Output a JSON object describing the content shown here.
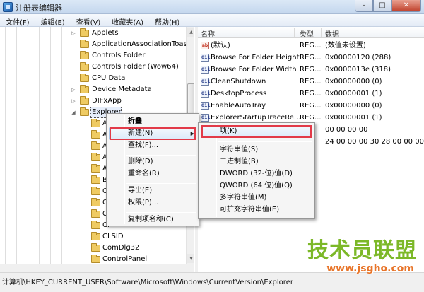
{
  "window": {
    "title": "注册表编辑器",
    "controls": {
      "minimize": "–",
      "maximize": "□",
      "close": "✕"
    }
  },
  "menubar": [
    "文件(F)",
    "编辑(E)",
    "查看(V)",
    "收藏夹(A)",
    "帮助(H)"
  ],
  "tree": {
    "items": [
      {
        "label": "Applets",
        "expandable": true,
        "selected": false
      },
      {
        "label": "ApplicationAssociationToasts",
        "expandable": false,
        "selected": false
      },
      {
        "label": "Controls Folder",
        "expandable": false,
        "selected": false
      },
      {
        "label": "Controls Folder (Wow64)",
        "expandable": false,
        "selected": false
      },
      {
        "label": "CPU Data",
        "expandable": false,
        "selected": false
      },
      {
        "label": "Device Metadata",
        "expandable": true,
        "selected": false
      },
      {
        "label": "DIFxApp",
        "expandable": true,
        "selected": false
      },
      {
        "label": "Explorer",
        "expandable": true,
        "expanded": true,
        "selected": true
      }
    ],
    "children": [
      {
        "label": "Ac"
      },
      {
        "label": "Ap"
      },
      {
        "label": "Au"
      },
      {
        "label": "Au"
      },
      {
        "label": "Au"
      },
      {
        "label": "Bi"
      },
      {
        "label": "Ca"
      },
      {
        "label": "Cl"
      },
      {
        "label": "Cl"
      },
      {
        "label": "Cl"
      },
      {
        "label": "CLSID"
      },
      {
        "label": "ComDlg32"
      },
      {
        "label": "ControlPanel"
      }
    ]
  },
  "list": {
    "columns": [
      "名称",
      "类型",
      "数据"
    ],
    "rows": [
      {
        "icon": "ab",
        "kind": "string",
        "name": "(默认)",
        "type": "REG...",
        "data": "(数值未设置)"
      },
      {
        "icon": "011",
        "kind": "binary",
        "name": "Browse For Folder Height",
        "type": "REG...",
        "data": "0x00000120 (288)"
      },
      {
        "icon": "011",
        "kind": "binary",
        "name": "Browse For Folder Width",
        "type": "REG...",
        "data": "0x0000013e (318)"
      },
      {
        "icon": "011",
        "kind": "binary",
        "name": "CleanShutdown",
        "type": "REG...",
        "data": "0x00000000 (0)"
      },
      {
        "icon": "011",
        "kind": "binary",
        "name": "DesktopProcess",
        "type": "REG...",
        "data": "0x00000001 (1)"
      },
      {
        "icon": "011",
        "kind": "binary",
        "name": "EnableAutoTray",
        "type": "REG...",
        "data": "0x00000000 (0)"
      },
      {
        "icon": "011",
        "kind": "binary",
        "name": "ExplorerStartupTraceRe...",
        "type": "REG...",
        "data": "0x00000001 (1)"
      },
      {
        "icon": "",
        "kind": "hidden",
        "name": "",
        "type": "",
        "data": "00 00 00 00"
      },
      {
        "icon": "",
        "kind": "hidden",
        "name": "",
        "type": "",
        "data": "24 00 00 00 30 28 00 00 00 00"
      }
    ]
  },
  "context_menu": {
    "items": [
      {
        "label": "折叠",
        "bold": true
      },
      {
        "label": "新建(N)",
        "submenu": true,
        "highlighted": true
      },
      {
        "label": "查找(F)..."
      },
      {
        "separator": true
      },
      {
        "label": "删除(D)"
      },
      {
        "label": "重命名(R)"
      },
      {
        "separator": true
      },
      {
        "label": "导出(E)"
      },
      {
        "label": "权限(P)..."
      },
      {
        "separator": true
      },
      {
        "label": "复制项名称(C)"
      }
    ]
  },
  "submenu": {
    "items": [
      {
        "label": "项(K)",
        "highlighted": true
      },
      {
        "separator": true
      },
      {
        "label": "字符串值(S)"
      },
      {
        "label": "二进制值(B)"
      },
      {
        "label": "DWORD (32-位)值(D)"
      },
      {
        "label": "QWORD (64 位)值(Q)"
      },
      {
        "label": "多字符串值(M)"
      },
      {
        "label": "可扩充字符串值(E)"
      }
    ]
  },
  "statusbar": {
    "path": "计算机\\HKEY_CURRENT_USER\\Software\\Microsoft\\Windows\\CurrentVersion\\Explorer"
  },
  "watermark": {
    "logo": "技术员联盟",
    "url": "www.jsgho.com"
  },
  "colors": {
    "highlight_border": "#e23a48",
    "watermark_green": "#7cb828",
    "watermark_orange": "#e8752a"
  }
}
